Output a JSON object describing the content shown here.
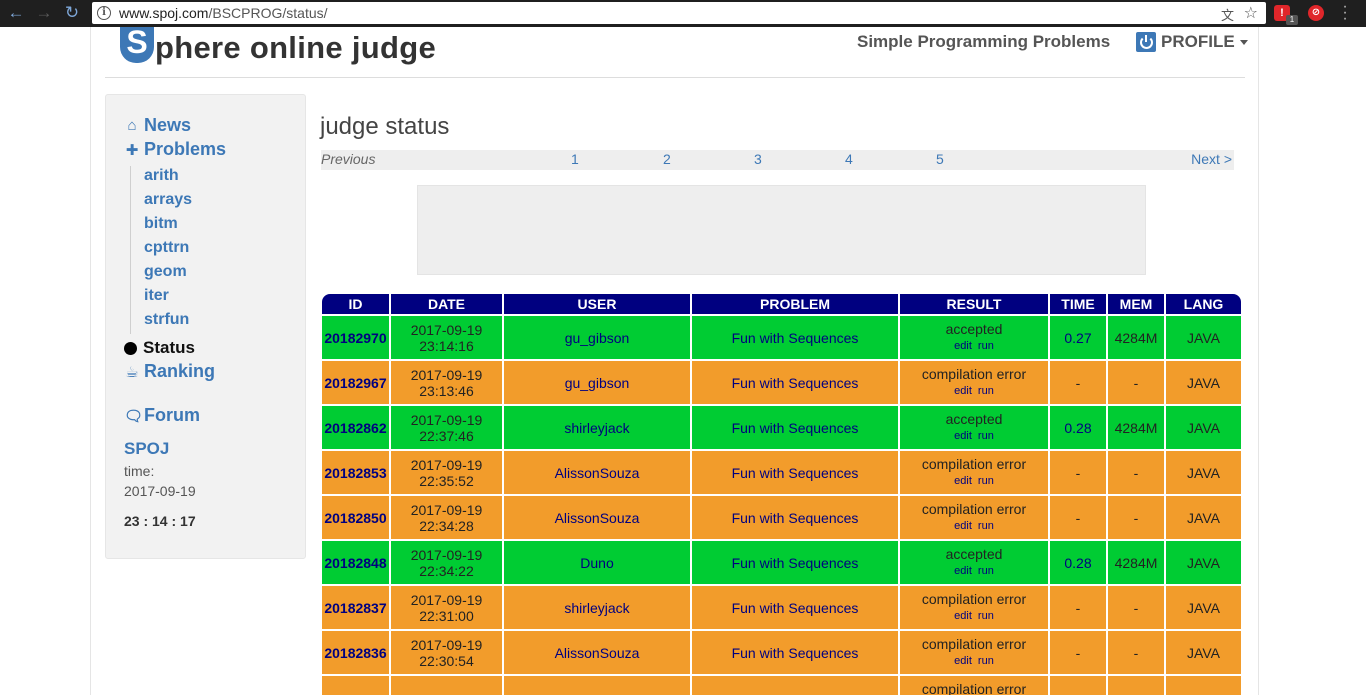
{
  "browser": {
    "url_host": "www.spoj.com",
    "url_path": "/BSCPROG/status/",
    "ext_badge": "1"
  },
  "header": {
    "logo_letter": "S",
    "logo_text": "phere online judge",
    "site_title": "Simple Programming Problems",
    "profile_label": "PROFILE"
  },
  "sidebar": {
    "news": "News",
    "problems": "Problems",
    "sub_items": [
      "arith",
      "arrays",
      "bitm",
      "cpttrn",
      "geom",
      "iter",
      "strfun"
    ],
    "status": "Status",
    "ranking": "Ranking",
    "forum": "Forum",
    "spoj": "SPOJ",
    "time_label": "time:",
    "date": "2017-09-19",
    "clock": "23 : 14 : 17"
  },
  "main": {
    "title": "judge status",
    "pager": {
      "previous": "Previous",
      "pages": [
        "1",
        "2",
        "3",
        "4",
        "5"
      ],
      "next": "Next >"
    }
  },
  "table": {
    "headers": [
      "ID",
      "DATE",
      "USER",
      "PROBLEM",
      "RESULT",
      "TIME",
      "MEM",
      "LANG"
    ],
    "edit_label": "edit",
    "run_label": "run",
    "rows": [
      {
        "id": "20182970",
        "date": "2017-09-19 23:14:16",
        "user": "gu_gibson",
        "problem": "Fun with Sequences",
        "result": "accepted",
        "time": "0.27",
        "mem": "4284M",
        "lang": "JAVA",
        "status": "ok"
      },
      {
        "id": "20182967",
        "date": "2017-09-19 23:13:46",
        "user": "gu_gibson",
        "problem": "Fun with Sequences",
        "result": "compilation error",
        "time": "-",
        "mem": "-",
        "lang": "JAVA",
        "status": "ce"
      },
      {
        "id": "20182862",
        "date": "2017-09-19 22:37:46",
        "user": "shirleyjack",
        "problem": "Fun with Sequences",
        "result": "accepted",
        "time": "0.28",
        "mem": "4284M",
        "lang": "JAVA",
        "status": "ok"
      },
      {
        "id": "20182853",
        "date": "2017-09-19 22:35:52",
        "user": "AlissonSouza",
        "problem": "Fun with Sequences",
        "result": "compilation error",
        "time": "-",
        "mem": "-",
        "lang": "JAVA",
        "status": "ce"
      },
      {
        "id": "20182850",
        "date": "2017-09-19 22:34:28",
        "user": "AlissonSouza",
        "problem": "Fun with Sequences",
        "result": "compilation error",
        "time": "-",
        "mem": "-",
        "lang": "JAVA",
        "status": "ce"
      },
      {
        "id": "20182848",
        "date": "2017-09-19 22:34:22",
        "user": "Duno",
        "problem": "Fun with Sequences",
        "result": "accepted",
        "time": "0.28",
        "mem": "4284M",
        "lang": "JAVA",
        "status": "ok"
      },
      {
        "id": "20182837",
        "date": "2017-09-19 22:31:00",
        "user": "shirleyjack",
        "problem": "Fun with Sequences",
        "result": "compilation error",
        "time": "-",
        "mem": "-",
        "lang": "JAVA",
        "status": "ce"
      },
      {
        "id": "20182836",
        "date": "2017-09-19 22:30:54",
        "user": "AlissonSouza",
        "problem": "Fun with Sequences",
        "result": "compilation error",
        "time": "-",
        "mem": "-",
        "lang": "JAVA",
        "status": "ce"
      },
      {
        "id": "",
        "date": "",
        "user": "",
        "problem": "",
        "result": "compilation error",
        "time": "",
        "mem": "",
        "lang": "",
        "status": "ce"
      }
    ]
  },
  "colors": {
    "accepted": "#00cc33",
    "compilation_error": "#f29c2b",
    "header_navy": "#000080",
    "link_blue": "#3d78b6"
  }
}
